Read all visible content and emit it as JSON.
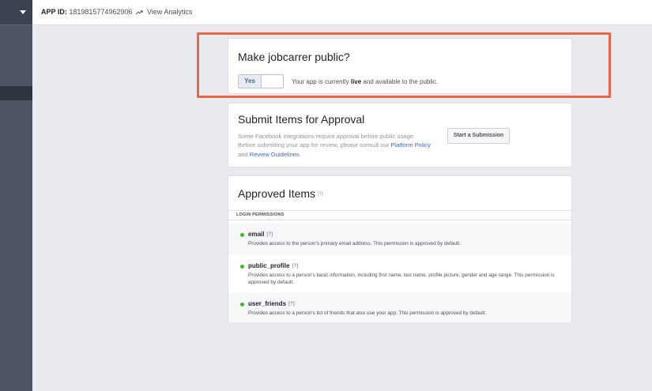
{
  "topbar": {
    "app_id_label": "APP ID:",
    "app_id_value": "1819815774962906",
    "analytics_label": "View Analytics"
  },
  "public_card": {
    "title": "Make jobcarrer public?",
    "toggle_label": "Yes",
    "status_prefix": "Your app is currently ",
    "status_bold": "live",
    "status_suffix": " and available to the public."
  },
  "submit_card": {
    "title": "Submit Items for Approval",
    "desc_part1": "Some Facebook integrations require approval before public usage. Before submitting your app for review, please consult our ",
    "link_platform": "Platform Policy",
    "desc_and": " and ",
    "link_review": "Review Guidelines",
    "desc_end": ".",
    "button_label": "Start a Submission"
  },
  "approved_card": {
    "title": "Approved Items",
    "help": "[?]",
    "section_label": "LOGIN PERMISSIONS",
    "items": [
      {
        "name": "email",
        "help": "[?]",
        "desc": "Provides access to the person's primary email address. This permission is approved by default."
      },
      {
        "name": "public_profile",
        "help": "[?]",
        "desc": "Provides access to a person's basic information, including first name, last name, profile picture, gender and age range. This permission is approved by default."
      },
      {
        "name": "user_friends",
        "help": "[?]",
        "desc": "Provides access to a person's list of friends that also use your app. This permission is approved by default."
      }
    ]
  },
  "colors": {
    "highlight": "#e8674d",
    "approved_dot": "#42b72a",
    "link": "#4267b2",
    "sidebar": "#4e5665"
  }
}
